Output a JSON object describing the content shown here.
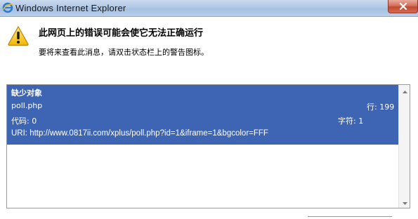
{
  "window": {
    "title": "Windows Internet Explorer",
    "icon": "ie-icon",
    "close_icon": "close-icon"
  },
  "message": {
    "icon": "warning-icon",
    "heading": "此网页上的错误可能会使它无法正确运行",
    "subtext": "要将来查看此消息，请双击状态栏上的警告图标。"
  },
  "details": {
    "title": "缺少对象",
    "file": "poll.php",
    "line_label": "行: 199",
    "code_label": "代码: 0",
    "char_label": "字符: 1",
    "uri": "URI: http://www.0817ii.com/xplus/poll.php?id=1&iframe=1&bgcolor=FFF"
  },
  "colors": {
    "selection": "#3d65b3",
    "titlebar": "#b1c8e6",
    "close": "#c24a31"
  }
}
